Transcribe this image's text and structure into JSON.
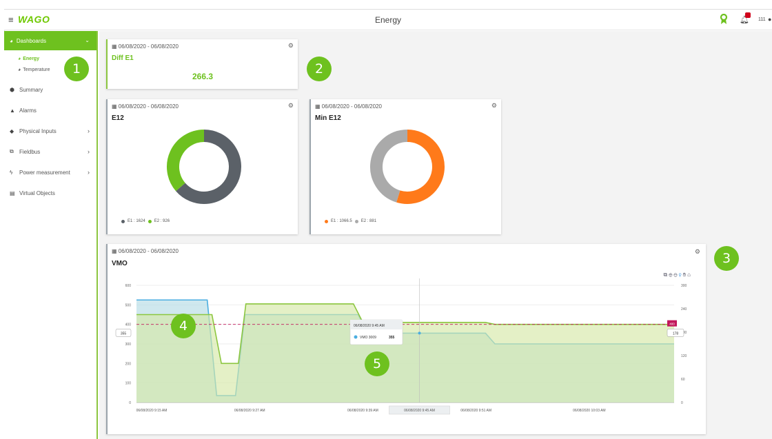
{
  "header": {
    "menu_icon": "hamburger-icon",
    "logo": "WAGO",
    "title": "Energy",
    "badge_count": "",
    "user_label": "111"
  },
  "sidebar": {
    "dashboards": "Dashboards",
    "energy": "Energy",
    "temperature": "Temperature",
    "items": [
      {
        "label": "Summary",
        "icon": "cube-icon",
        "chev": false
      },
      {
        "label": "Alarms",
        "icon": "bell-icon",
        "chev": false
      },
      {
        "label": "Physical Inputs",
        "icon": "tag-icon",
        "chev": true
      },
      {
        "label": "Fieldbus",
        "icon": "network-icon",
        "chev": true
      },
      {
        "label": "Power measurement",
        "icon": "bolt-icon",
        "chev": true
      },
      {
        "label": "Virtual Objects",
        "icon": "calculator-icon",
        "chev": false
      }
    ]
  },
  "cards": {
    "diff": {
      "date": "06/08/2020 - 06/08/2020",
      "title": "Diff E1",
      "value": "266.3"
    },
    "e12": {
      "date": "06/08/2020 - 06/08/2020",
      "title": "E12",
      "legend": [
        {
          "label": "E1 : 1624",
          "color": "#5b6168"
        },
        {
          "label": "E2 : 926",
          "color": "#6ec11f"
        }
      ]
    },
    "min_e12": {
      "date": "06/08/2020 - 06/08/2020",
      "title": "Min E12",
      "legend": [
        {
          "label": "E1 : 1066.5",
          "color": "#ff7a1a"
        },
        {
          "label": "E2 : 881",
          "color": "#aaaaaa"
        }
      ]
    },
    "vmo": {
      "date": "06/08/2020 - 06/08/2020",
      "title": "VMO"
    }
  },
  "chart_data": [
    {
      "type": "pie",
      "title": "E12",
      "labels": [
        "E1",
        "E2"
      ],
      "values": [
        1624,
        926
      ],
      "colors": [
        "#5b6168",
        "#6ec11f"
      ]
    },
    {
      "type": "pie",
      "title": "Min E12",
      "labels": [
        "E1",
        "E2"
      ],
      "values": [
        1066.5,
        881
      ],
      "colors": [
        "#ff7a1a",
        "#aaaaaa"
      ]
    },
    {
      "type": "area",
      "title": "VMO",
      "x_ticks": [
        "06/08/2020 9:15 AM",
        "06/08/2020 9:27 AM",
        "06/08/2020 9:39 AM",
        "06/08/2020 9:45 AM",
        "06/08/2020 9:51 AM",
        "06/08/2020 10:03 AM"
      ],
      "y_left_ticks": [
        "600",
        "500",
        "400",
        "300",
        "200",
        "100",
        "0"
      ],
      "y_right_ticks": [
        "300",
        "240",
        "180",
        "120",
        "60",
        "0"
      ],
      "ylim_left": [
        0,
        600
      ],
      "ylim_right": [
        0,
        300
      ],
      "x_minutes": [
        0,
        57
      ],
      "series": [
        {
          "axis": "left",
          "color": "#4aaee0",
          "fill": "#b5dbe5",
          "x": [
            0,
            7.5,
            8.5,
            10.5,
            11.5,
            23.5,
            24.5,
            37,
            38,
            57
          ],
          "y": [
            525,
            525,
            35,
            35,
            450,
            450,
            355,
            355,
            300,
            300
          ]
        },
        {
          "axis": "left",
          "color": "#8cc63f",
          "fill": "#d6e8a8",
          "x": [
            0,
            8,
            9,
            10.8,
            11.6,
            23,
            24,
            37,
            38,
            57
          ],
          "y": [
            450,
            450,
            200,
            200,
            505,
            505,
            410,
            410,
            400,
            400
          ]
        }
      ],
      "threshold_left": 400,
      "crosshair_x_label": "06/08/2020 9:45 AM",
      "left_marker": "355",
      "right_marker": "178",
      "right_flag": "400",
      "tooltip": {
        "title": "06/08/2020 9:45 AM",
        "series": "VMO 3009",
        "value": "355"
      }
    }
  ],
  "callouts": [
    "1",
    "2",
    "3",
    "4",
    "5"
  ]
}
